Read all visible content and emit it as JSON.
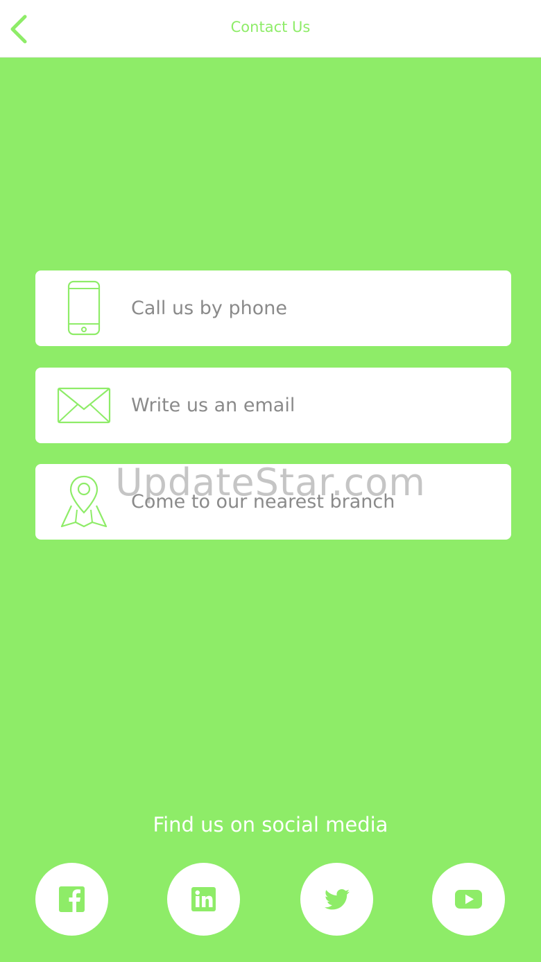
{
  "header": {
    "title": "Contact Us",
    "back_icon": "chevron-left-icon"
  },
  "contact_options": [
    {
      "label": "Call us by phone",
      "icon": "phone-icon"
    },
    {
      "label": "Write us an email",
      "icon": "envelope-icon"
    },
    {
      "label": "Come to our nearest branch",
      "icon": "map-pin-icon"
    }
  ],
  "watermark": "UpdateStar.com",
  "social": {
    "title": "Find us on social media",
    "items": [
      {
        "icon": "facebook-icon"
      },
      {
        "icon": "linkedin-icon"
      },
      {
        "icon": "twitter-icon"
      },
      {
        "icon": "youtube-icon"
      }
    ]
  },
  "colors": {
    "accent": "#8eec68",
    "text_gray": "#8a8a8a",
    "card": "#ffffff"
  }
}
